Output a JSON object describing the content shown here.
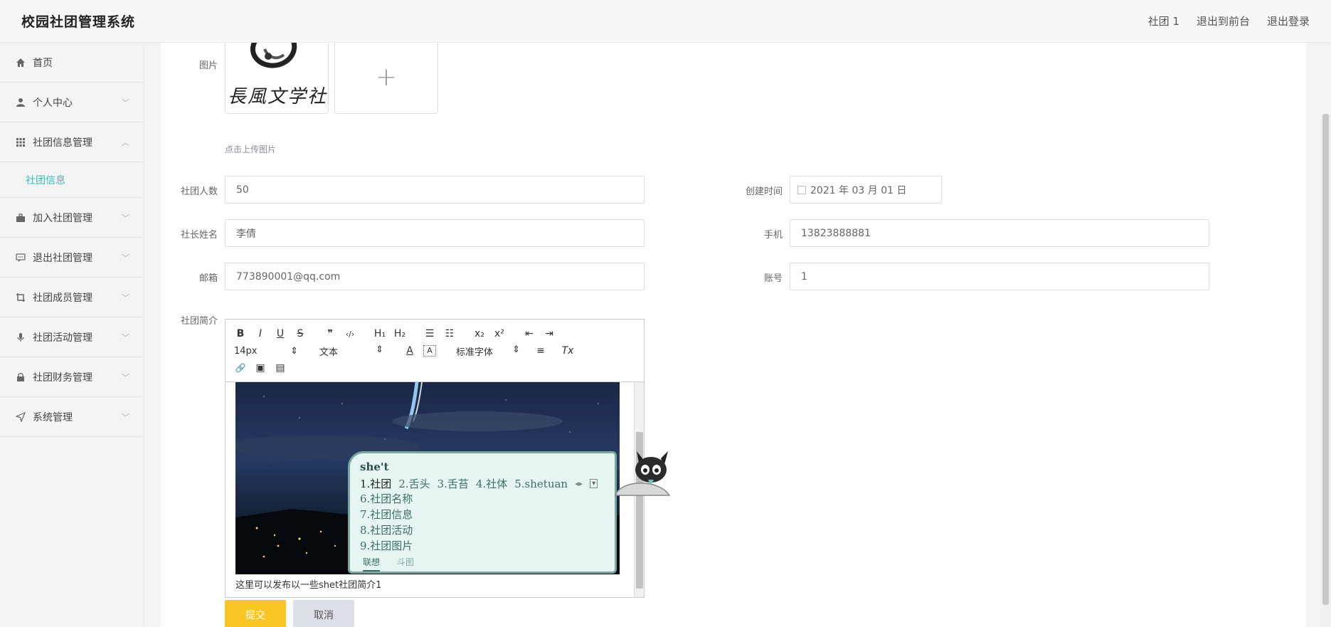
{
  "app": {
    "title": "校园社团管理系统"
  },
  "top_links": [
    "社团 1",
    "退出到前台",
    "退出登录"
  ],
  "sidebar": {
    "items": [
      {
        "label": "首页",
        "icon": "home-icon",
        "chevron": ""
      },
      {
        "label": "个人中心",
        "icon": "user-icon",
        "chevron": "﹀"
      },
      {
        "label": "社团信息管理",
        "icon": "grid-icon",
        "chevron": "︿"
      },
      {
        "label": "加入社团管理",
        "icon": "briefcase-icon",
        "chevron": "﹀"
      },
      {
        "label": "退出社团管理",
        "icon": "chat-icon",
        "chevron": "﹀"
      },
      {
        "label": "社团成员管理",
        "icon": "crop-icon",
        "chevron": "﹀"
      },
      {
        "label": "社团活动管理",
        "icon": "microphone-icon",
        "chevron": "﹀"
      },
      {
        "label": "社团财务管理",
        "icon": "lock-icon",
        "chevron": "﹀"
      },
      {
        "label": "系统管理",
        "icon": "send-icon",
        "chevron": "﹀"
      }
    ],
    "submenu": {
      "label": "社团信息"
    }
  },
  "form": {
    "image_label": "图片",
    "upload_text": "点击上传图片",
    "uploaded_logo_text": "長風文学社",
    "add_symbol": "+",
    "members_label": "社团人数",
    "members_value": "50",
    "created_label": "创建时间",
    "created_value": "2021 年 03 月 01 日",
    "leader_label": "社长姓名",
    "leader_value": "李倩",
    "phone_label": "手机",
    "phone_value": "13823888881",
    "email_label": "邮箱",
    "email_value": "773890001@qq.com",
    "account_label": "账号",
    "account_value": "1",
    "intro_label": "社团简介"
  },
  "editor": {
    "toolbar": {
      "bold": "B",
      "italic": "I",
      "underline": "U",
      "strike": "S",
      "quote": "❞",
      "code": "‹/›",
      "h1": "H₁",
      "h2": "H₂",
      "ol": "☰",
      "ul": "☷",
      "sub": "x₂",
      "sup": "x²",
      "indent_left": "⇤",
      "indent_right": "⇥",
      "size": "14px",
      "text": "文本",
      "font": "标准字体",
      "color": "A",
      "bg": "A",
      "align": "≡",
      "clear": "Tx",
      "link": "🔗",
      "image": "▣",
      "video": "▤"
    },
    "body_text": "这里可以发布以一些shet社团简介1"
  },
  "ime": {
    "input": "she't",
    "candidates": [
      "1.社团",
      "2.舌头",
      "3.舌苔",
      "4.社体",
      "5.shetuan"
    ],
    "more": [
      "6.社团名称",
      "7.社团信息",
      "8.社团活动",
      "9.社团图片"
    ],
    "tabs": [
      "联想",
      "斗图"
    ]
  },
  "buttons": {
    "submit": "提交",
    "cancel": "取消"
  },
  "colors": {
    "accent": "#33c1b8",
    "submit": "#f9c623",
    "cancel": "#dcdfe6"
  }
}
